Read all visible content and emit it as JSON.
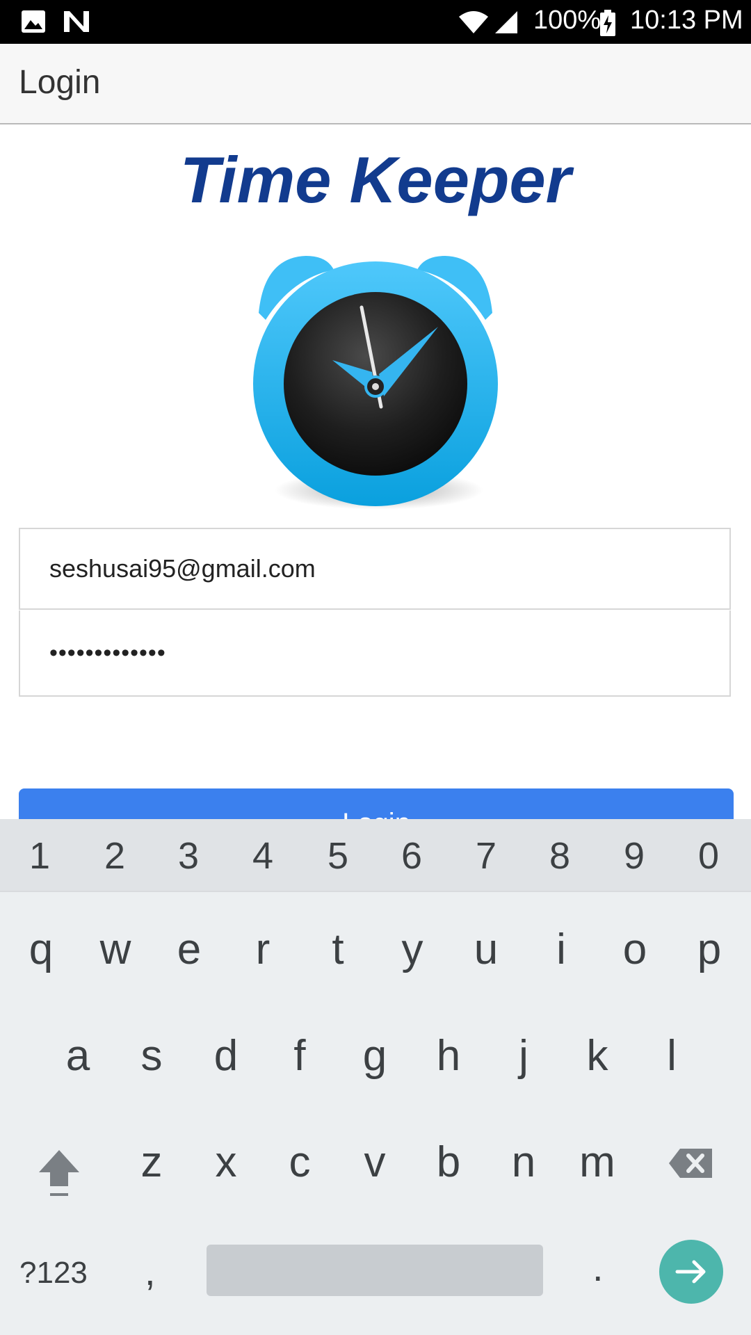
{
  "status_bar": {
    "battery": "100%",
    "time": "10:13 PM",
    "icons": [
      "image-icon",
      "n-icon",
      "wifi-icon",
      "signal-icon",
      "battery-charging-icon"
    ]
  },
  "app_bar": {
    "title": "Login"
  },
  "main": {
    "app_name": "Time Keeper",
    "logo_icon": "alarm-clock-icon",
    "email_value": "seshusai95@gmail.com",
    "password_value": "•••••••••••••",
    "login_button": "Login"
  },
  "keyboard": {
    "number_row": [
      "1",
      "2",
      "3",
      "4",
      "5",
      "6",
      "7",
      "8",
      "9",
      "0"
    ],
    "row1": [
      "q",
      "w",
      "e",
      "r",
      "t",
      "y",
      "u",
      "i",
      "o",
      "p"
    ],
    "row2": [
      "a",
      "s",
      "d",
      "f",
      "g",
      "h",
      "j",
      "k",
      "l"
    ],
    "row3": [
      "z",
      "x",
      "c",
      "v",
      "b",
      "n",
      "m"
    ],
    "symbols_key": "?123",
    "comma_key": ",",
    "period_key": ".",
    "accent_color": "#4db6ac"
  },
  "colors": {
    "title": "#123b8e",
    "button": "#3b80ee",
    "clock_ring": "#29b6f6"
  }
}
